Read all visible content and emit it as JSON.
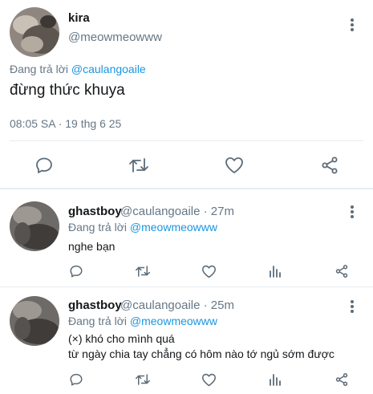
{
  "main_tweet": {
    "name": "kira",
    "handle": "@meowmeowww",
    "replying_prefix": "Đang trả lời ",
    "replying_to": "@caulangoaile",
    "text": "đừng thức khuya",
    "timestamp": "08:05 SA · 19 thg 6 25"
  },
  "replies": [
    {
      "name": "ghastboy",
      "meta": "@caulangoaile · 27m",
      "replying_prefix": "Đang trả lời ",
      "replying_to": "@meowmeowww",
      "text_lines": [
        "nghe bạn"
      ]
    },
    {
      "name": "ghastboy",
      "meta": "@caulangoaile · 25m",
      "replying_prefix": "Đang trả lời ",
      "replying_to": "@meowmeowww",
      "text_lines": [
        "(×) khó cho mình quá",
        "từ ngày chia tay chẳng có hôm nào tớ ngủ sớm được"
      ]
    }
  ],
  "colors": {
    "accent": "#1b95e0",
    "icon": "#5b6b78",
    "divider": "#e6ecf0"
  }
}
